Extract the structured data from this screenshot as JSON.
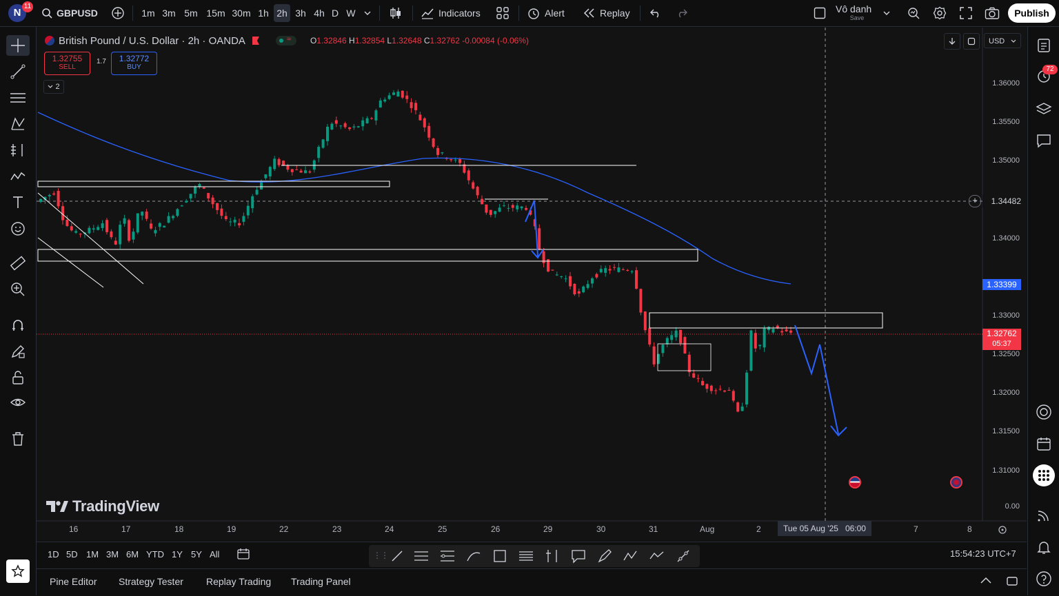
{
  "topbar": {
    "avatar_letter": "N",
    "notif_count": "11",
    "symbol": "GBPUSD",
    "intervals": [
      "1m",
      "3m",
      "5m",
      "15m",
      "30m",
      "1h",
      "2h",
      "3h",
      "4h",
      "D",
      "W"
    ],
    "active_interval": "2h",
    "indicators_label": "Indicators",
    "alert_label": "Alert",
    "replay_label": "Replay",
    "layout_name": "Vô danh",
    "layout_sub": "Save",
    "publish_label": "Publish"
  },
  "legend": {
    "title": "British Pound / U.S. Dollar · 2h · OANDA",
    "o_label": "O",
    "o": "1.32846",
    "h_label": "H",
    "h": "1.32854",
    "l_label": "L",
    "l": "1.32648",
    "c_label": "C",
    "c": "1.32762",
    "change": "-0.00084 (-0.06%)",
    "sell_price": "1.32755",
    "sell_label": "SELL",
    "spread": "1.7",
    "buy_price": "1.32772",
    "buy_label": "BUY",
    "indicator_count": "2"
  },
  "chart_controls": {
    "currency": "USD"
  },
  "price_axis": {
    "ticks": [
      "1.36000",
      "1.35500",
      "1.35000",
      "1.34500",
      "1.34000",
      "1.33500",
      "1.33000",
      "1.32500",
      "1.32000",
      "1.31500",
      "1.31000",
      "0.00"
    ],
    "crosshair_price": "1.34482",
    "ma_price": "1.33399",
    "last_price": "1.32762",
    "countdown": "05:37"
  },
  "time_axis": {
    "ticks": [
      "16",
      "17",
      "18",
      "19",
      "22",
      "23",
      "24",
      "25",
      "26",
      "29",
      "30",
      "31",
      "Aug",
      "2",
      "7",
      "8"
    ],
    "crosshair_label": "Tue 05 Aug '25",
    "crosshair_time": "06:00"
  },
  "watermark": "TradingView",
  "bottombar": {
    "ranges": [
      "1D",
      "5D",
      "1M",
      "3M",
      "6M",
      "YTD",
      "1Y",
      "5Y",
      "All"
    ],
    "clock": "15:54:23 UTC+7"
  },
  "panel_tabs": [
    "Pine Editor",
    "Strategy Tester",
    "Replay Trading",
    "Trading Panel"
  ],
  "rightbar": {
    "badge": "72"
  },
  "colors": {
    "up": "#089981",
    "down": "#f23645",
    "ma": "#2962ff",
    "background": "#131313",
    "price_label": "#f23645",
    "ma_label": "#2962ff"
  }
}
